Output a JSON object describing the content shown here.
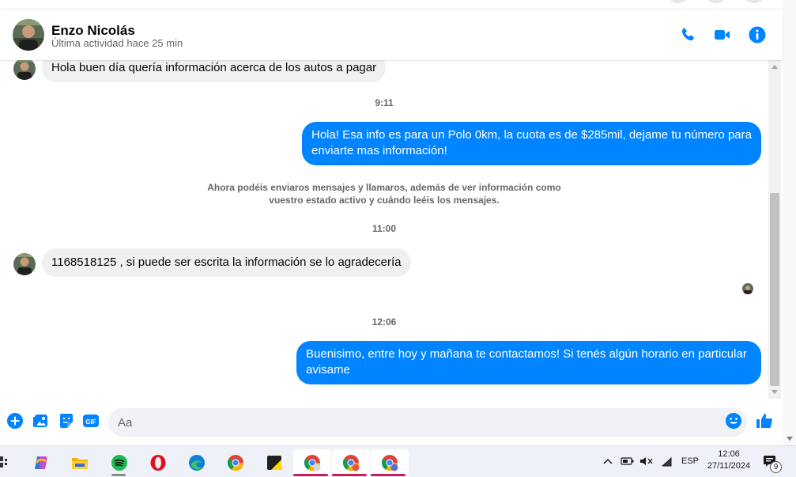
{
  "header": {
    "name": "Enzo Nicolás",
    "status": "Última actividad hace 25 min",
    "icons": [
      "phone-icon",
      "video-icon",
      "info-icon"
    ],
    "accent": "#0084ff"
  },
  "messages": [
    {
      "type": "incoming",
      "text": "Hola buen día quería información acerca de los autos a pagar"
    },
    {
      "type": "timestamp",
      "text": "9:11"
    },
    {
      "type": "outgoing",
      "lines": [
        "Hola! Esa info es para un Polo 0km, la cuota es de $285mil, dejame tu número para",
        "enviarte mas información!"
      ]
    },
    {
      "type": "system",
      "lines": [
        "Ahora podéis enviaros mensajes y llamaros, además de ver información como",
        "vuestro estado activo y cuándo leéis los mensajes."
      ]
    },
    {
      "type": "timestamp",
      "text": "11:00"
    },
    {
      "type": "incoming",
      "text": "1168518125 , si puede ser escrita la información se lo agradecería"
    },
    {
      "type": "timestamp",
      "text": "12:06"
    },
    {
      "type": "outgoing",
      "lines": [
        "Buenisimo, entre hoy y mañana te contactamos! Si tenés algún horario en particular",
        "avisame"
      ]
    }
  ],
  "composer": {
    "placeholder": "Aa",
    "icons": [
      "plus-icon",
      "image-icon",
      "sticker-icon",
      "gif-icon",
      "emoji-icon",
      "like-icon"
    ]
  },
  "taskbar": {
    "apps": [
      "widgets-icon",
      "copilot-icon",
      "file-explorer-icon",
      "spotify-icon",
      "opera-icon",
      "edge-icon",
      "chrome-icon",
      "sticky-notes-icon",
      "chrome-profile-1-icon",
      "chrome-profile-2-icon",
      "chrome-profile-3-icon"
    ],
    "language": "ESP",
    "time": "12:06",
    "date": "27/11/2024",
    "notification_count": "9"
  }
}
